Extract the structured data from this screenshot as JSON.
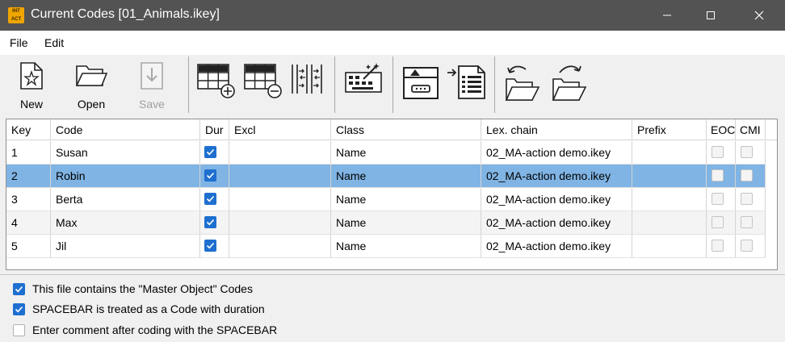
{
  "window": {
    "title": "Current Codes [01_Animals.ikey]",
    "app_icon_text": "INT ACT"
  },
  "menu": {
    "file": "File",
    "edit": "Edit"
  },
  "toolbar": {
    "new_label": "New",
    "open_label": "Open",
    "save_label": "Save",
    "save_disabled": true
  },
  "table": {
    "columns": [
      "Key",
      "Code",
      "Dur",
      "Excl",
      "Class",
      "Lex. chain",
      "Prefix",
      "EOC",
      "CMI"
    ],
    "rows": [
      {
        "key": "1",
        "code": "Susan",
        "dur": true,
        "excl": "",
        "class": "Name",
        "lex_chain": "02_MA-action demo.ikey",
        "prefix": "",
        "eoc": false,
        "cmi": false
      },
      {
        "key": "2",
        "code": "Robin",
        "dur": true,
        "excl": "",
        "class": "Name",
        "lex_chain": "02_MA-action demo.ikey",
        "prefix": "",
        "eoc": false,
        "cmi": false,
        "selected": true
      },
      {
        "key": "3",
        "code": "Berta",
        "dur": true,
        "excl": "",
        "class": "Name",
        "lex_chain": "02_MA-action demo.ikey",
        "prefix": "",
        "eoc": false,
        "cmi": false
      },
      {
        "key": "4",
        "code": "Max",
        "dur": true,
        "excl": "",
        "class": "Name",
        "lex_chain": "02_MA-action demo.ikey",
        "prefix": "",
        "eoc": false,
        "cmi": false
      },
      {
        "key": "5",
        "code": "Jil",
        "dur": true,
        "excl": "",
        "class": "Name",
        "lex_chain": "02_MA-action demo.ikey",
        "prefix": "",
        "eoc": false,
        "cmi": false
      }
    ]
  },
  "options": [
    {
      "label": "This file contains the \"Master Object\" Codes",
      "checked": true
    },
    {
      "label": "SPACEBAR is treated as a Code with duration",
      "checked": true
    },
    {
      "label": "Enter comment after coding with the SPACEBAR",
      "checked": false
    }
  ],
  "colors": {
    "titlebar": "#535353",
    "selection": "#80b4e4",
    "checkbox_on": "#1e6fd0"
  }
}
